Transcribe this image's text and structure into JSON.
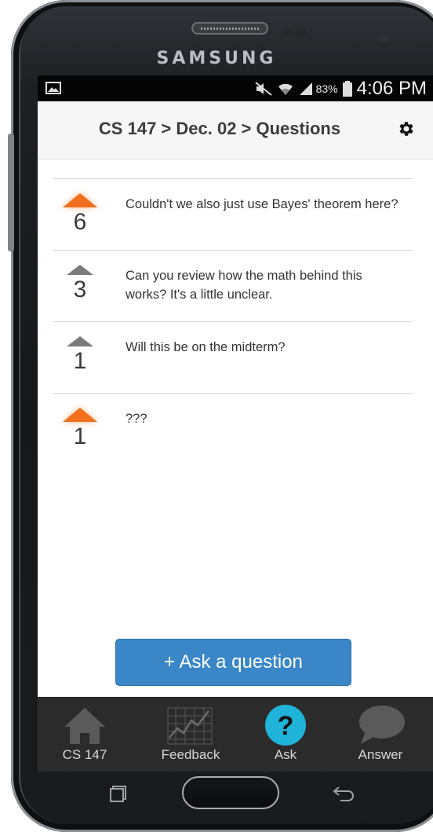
{
  "device": {
    "brand": "SAMSUNG"
  },
  "status_bar": {
    "battery_percent": "83%",
    "time": "4:06 PM"
  },
  "header": {
    "title": "CS 147 > Dec. 02 > Questions"
  },
  "questions": [
    {
      "votes": "6",
      "text": "Couldn't we also just use Bayes' theorem here?",
      "upvoted": true
    },
    {
      "votes": "3",
      "text": "Can you review how the math behind this works? It's a little unclear.",
      "upvoted": false
    },
    {
      "votes": "1",
      "text": "Will this be on the midterm?",
      "upvoted": false
    },
    {
      "votes": "1",
      "text": "???",
      "upvoted": true
    }
  ],
  "ask_button": {
    "label": "+ Ask a question"
  },
  "bottom_nav": [
    {
      "label": "CS 147",
      "icon": "home-icon",
      "active": false
    },
    {
      "label": "Feedback",
      "icon": "chart-icon",
      "active": false
    },
    {
      "label": "Ask",
      "icon": "question-icon",
      "active": true
    },
    {
      "label": "Answer",
      "icon": "speech-bubble-icon",
      "active": false
    }
  ],
  "colors": {
    "accent_orange": "#f26f1e",
    "button_blue": "#3a86c7",
    "ask_active": "#1fb3d9",
    "nav_bg": "#2b2b2b"
  }
}
